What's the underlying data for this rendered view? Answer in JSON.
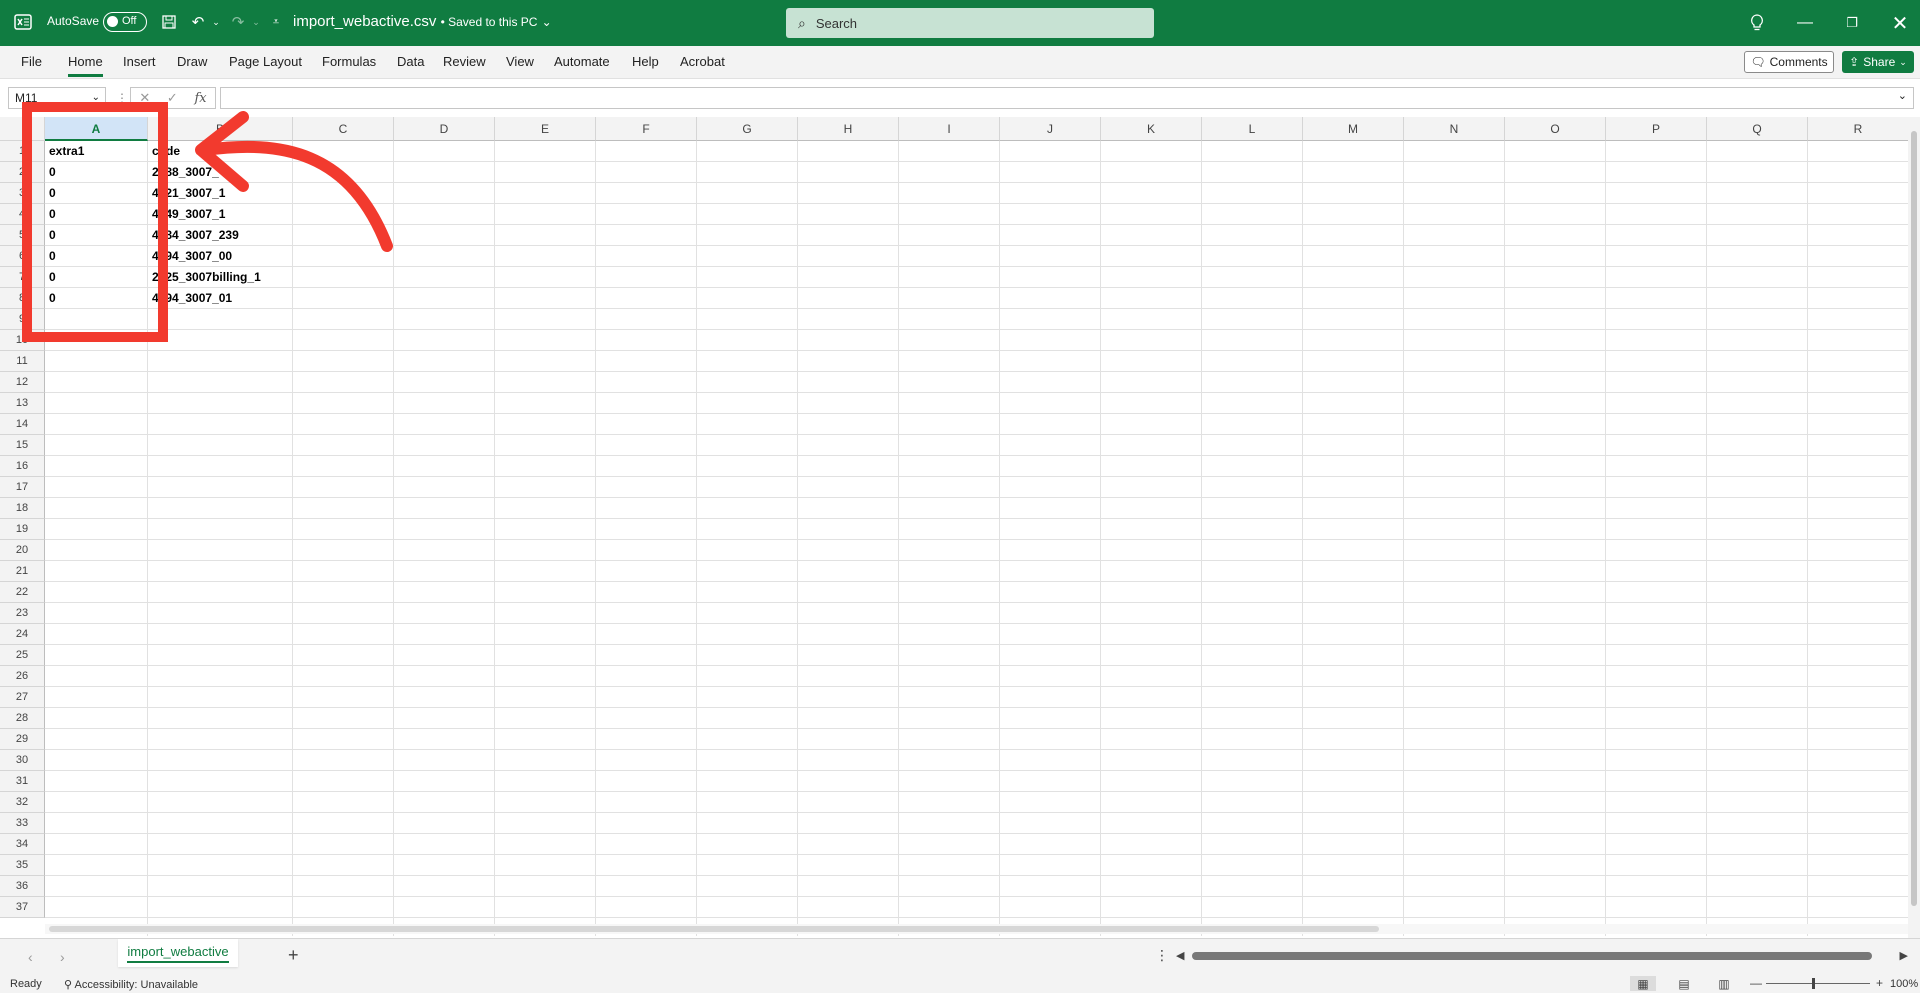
{
  "titlebar": {
    "autosave_label": "AutoSave",
    "autosave_state": "Off",
    "filename": "import_webactive.csv",
    "saved_status": "• Saved to this PC",
    "search_placeholder": "Search"
  },
  "ribbon": {
    "tabs": [
      "File",
      "Home",
      "Insert",
      "Draw",
      "Page Layout",
      "Formulas",
      "Data",
      "Review",
      "View",
      "Automate",
      "Help",
      "Acrobat"
    ],
    "active_tab": "Home",
    "comments_label": "Comments",
    "share_label": "Share"
  },
  "formula_bar": {
    "name_box": "M11",
    "fx": "fx",
    "content": ""
  },
  "grid": {
    "columns": [
      "A",
      "B",
      "C",
      "D",
      "E",
      "F",
      "G",
      "H",
      "I",
      "J",
      "K",
      "L",
      "M",
      "N",
      "O",
      "P",
      "Q",
      "R"
    ],
    "selected_column": "A",
    "rows": [
      "1",
      "2",
      "3",
      "4",
      "5",
      "6",
      "7",
      "8",
      "9",
      "10",
      "11",
      "12",
      "13",
      "14",
      "15",
      "16",
      "17",
      "18",
      "19",
      "20",
      "21",
      "22",
      "23",
      "24",
      "25",
      "26",
      "27",
      "28",
      "29",
      "30",
      "31",
      "32",
      "33",
      "34",
      "35",
      "36",
      "37"
    ],
    "data": [
      [
        "extra1",
        "code"
      ],
      [
        "0",
        "2088_3007_"
      ],
      [
        "0",
        "4021_3007_1"
      ],
      [
        "0",
        "4049_3007_1"
      ],
      [
        "0",
        "4084_3007_239"
      ],
      [
        "0",
        "4094_3007_00"
      ],
      [
        "0",
        "2025_3007billing_1"
      ],
      [
        "0",
        "4094_3007_01"
      ]
    ]
  },
  "sheets": {
    "tabs": [
      "import_webactive"
    ],
    "active": "import_webactive"
  },
  "statusbar": {
    "ready": "Ready",
    "accessibility": "Accessibility: Unavailable",
    "zoom": "100%"
  },
  "colors": {
    "brand": "#107c41",
    "annotation": "#f23a2e"
  }
}
